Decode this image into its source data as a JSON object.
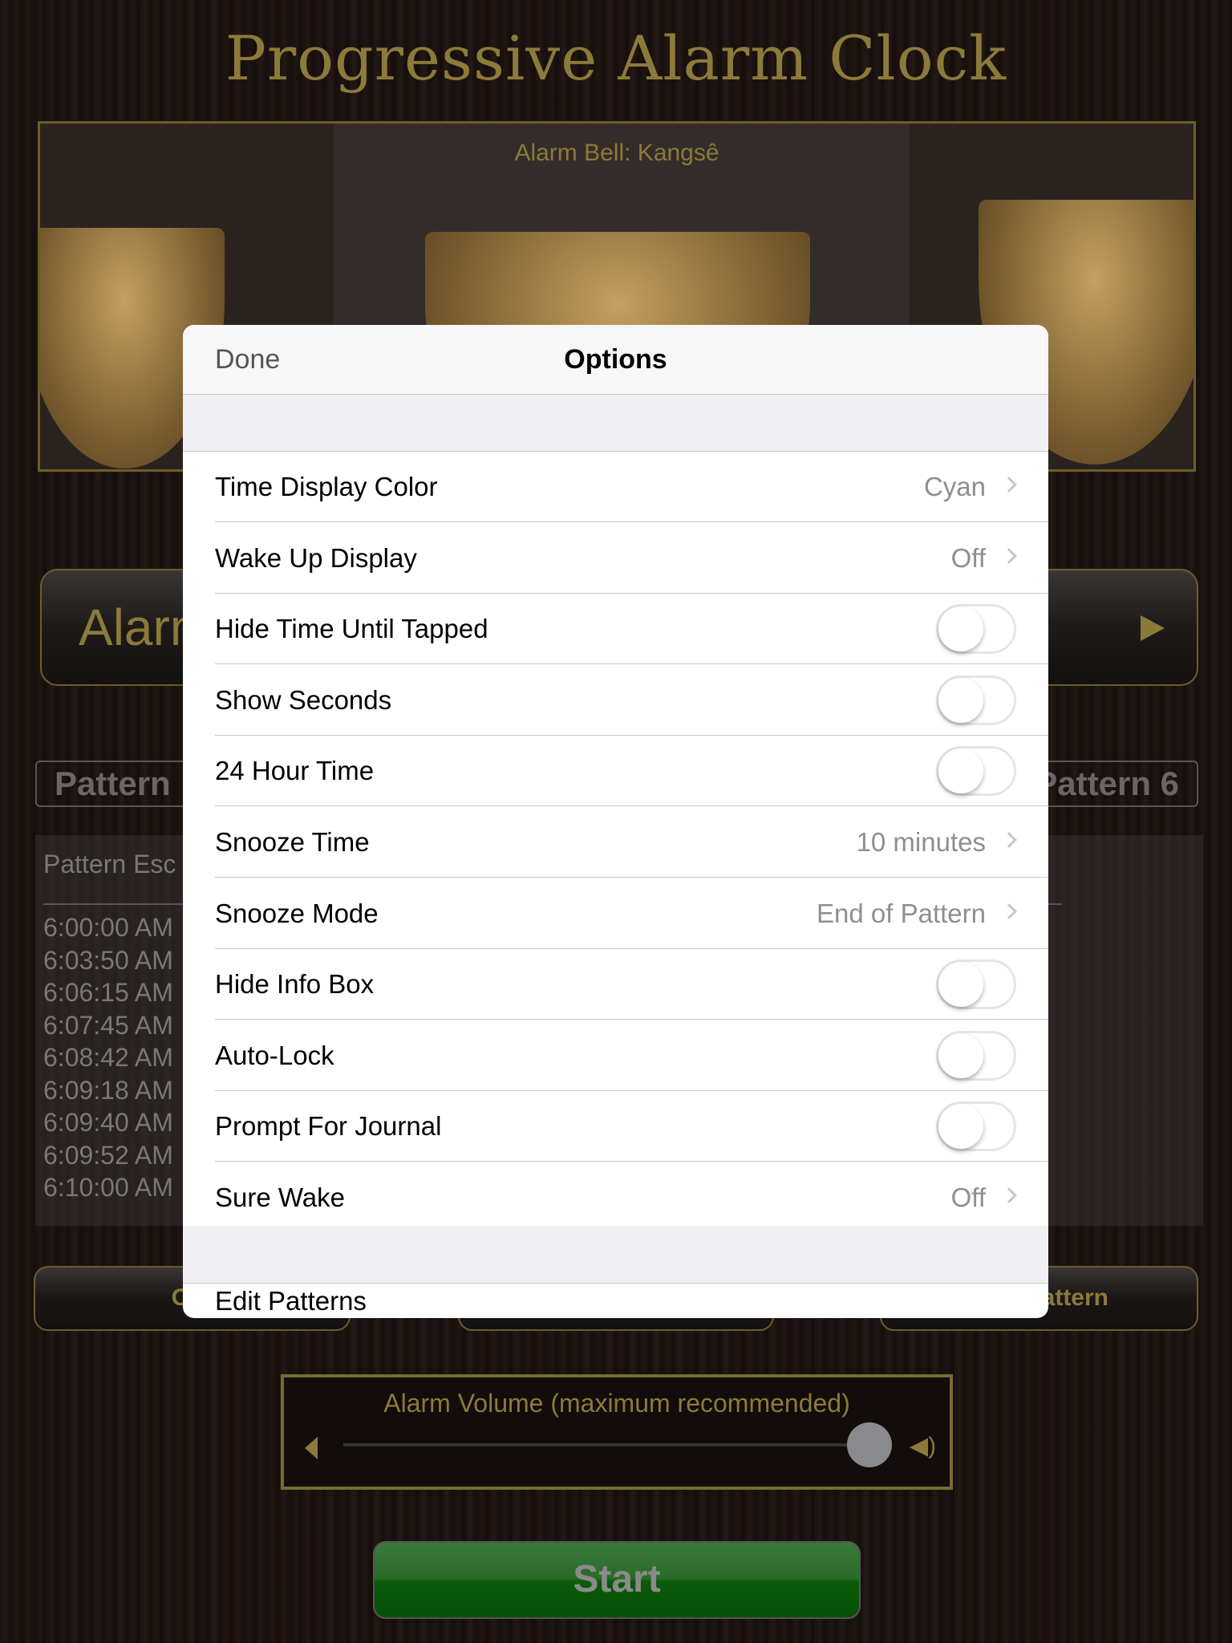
{
  "app": {
    "title": "Progressive Alarm Clock"
  },
  "bell": {
    "caption": "Alarm Bell: Kangsê"
  },
  "alarm_button": {
    "label": "Alarm"
  },
  "pattern_tabs": [
    "Pattern",
    "Pattern 6"
  ],
  "pattern_box": {
    "label": "Pattern Esc",
    "times": [
      "6:00:00 AM",
      "6:03:50 AM",
      "6:06:15 AM",
      "6:07:45 AM",
      "6:08:42 AM",
      "6:09:18 AM",
      "6:09:40 AM",
      "6:09:52 AM",
      "6:10:00 AM"
    ]
  },
  "bottom_buttons": [
    "Opt",
    "",
    "attern"
  ],
  "volume": {
    "label": "Alarm Volume (maximum recommended)",
    "level_percent": 100
  },
  "start_button": {
    "label": "Start"
  },
  "modal": {
    "done": "Done",
    "title": "Options",
    "rows": [
      {
        "label": "Time Display Color",
        "type": "disclosure",
        "value": "Cyan"
      },
      {
        "label": "Wake Up Display",
        "type": "disclosure",
        "value": "Off"
      },
      {
        "label": "Hide Time Until Tapped",
        "type": "toggle",
        "on": false
      },
      {
        "label": "Show Seconds",
        "type": "toggle",
        "on": false
      },
      {
        "label": "24 Hour Time",
        "type": "toggle",
        "on": false
      },
      {
        "label": "Snooze Time",
        "type": "disclosure",
        "value": "10 minutes"
      },
      {
        "label": "Snooze Mode",
        "type": "disclosure",
        "value": "End of Pattern"
      },
      {
        "label": "Hide Info Box",
        "type": "toggle",
        "on": false
      },
      {
        "label": "Auto-Lock",
        "type": "toggle",
        "on": false
      },
      {
        "label": "Prompt For Journal",
        "type": "toggle",
        "on": false
      },
      {
        "label": "Sure Wake",
        "type": "disclosure",
        "value": "Off"
      }
    ],
    "partial_row": "Edit Patterns"
  },
  "colors": {
    "gold": "#8c7a3a",
    "start_green": "#0a5a0a"
  }
}
